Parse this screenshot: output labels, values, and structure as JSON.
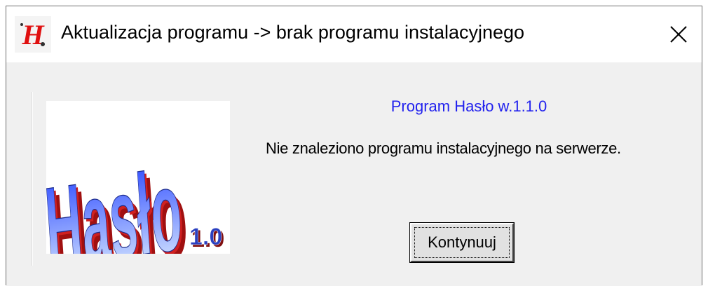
{
  "window": {
    "title": "Aktualizacja programu -> brak programu instalacyjnego",
    "app_icon": "hasło-app-icon",
    "close_icon": "close-icon"
  },
  "logo": {
    "word": "Hasło",
    "version": "1.0",
    "colors": {
      "gradient_top": "#1e3cff",
      "gradient_bottom": "#d8f0ff",
      "extrude": "#c81818"
    }
  },
  "dialog": {
    "version_label": "Program Hasło w.1.1.0",
    "message": "Nie znaleziono programu instalacyjnego na serwerze.",
    "continue_button": "Kontynuuj"
  },
  "colors": {
    "accent_text": "#2222ee",
    "body_bg": "#f0f0f0",
    "titlebar_bg": "#ffffff"
  }
}
